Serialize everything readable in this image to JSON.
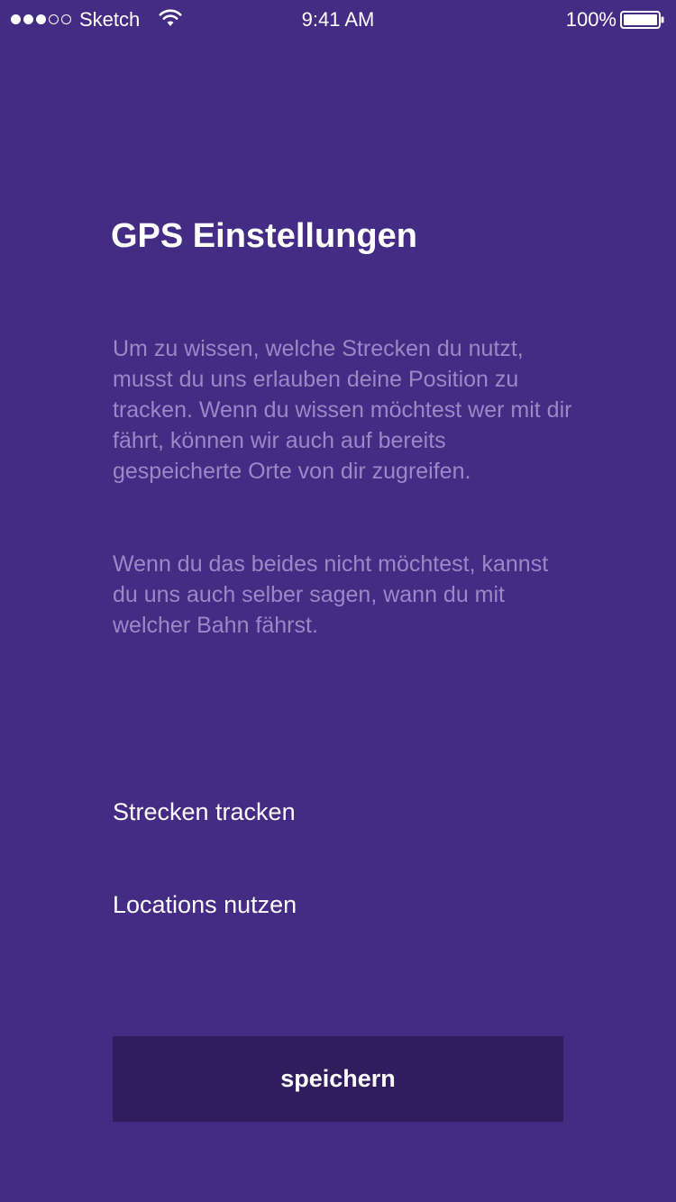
{
  "status_bar": {
    "carrier": "Sketch",
    "time": "9:41 AM",
    "battery_percent": "100%",
    "signal_filled": 3,
    "signal_total": 5,
    "icons": [
      "signal-dots-icon",
      "wifi-icon",
      "battery-icon"
    ]
  },
  "screen": {
    "title": "GPS Einstellungen",
    "paragraphs": [
      "Um zu wissen, welche Strecken du nutzt, musst du uns erlauben deine Position zu tracken. Wenn du wissen möchtest wer mit dir fährt, können wir auch auf bereits gespeicherte Orte von dir zugreifen.",
      "Wenn du das beides nicht möchtest, kannst du uns auch selber sagen, wann du mit welcher Bahn fährst."
    ],
    "options": [
      "Strecken tracken",
      "Locations nutzen"
    ],
    "save_label": "speichern"
  },
  "colors": {
    "background": "#442b83",
    "button_background": "#2f1d5e",
    "body_text": "#9b88c6",
    "primary_text": "#ffffff"
  }
}
